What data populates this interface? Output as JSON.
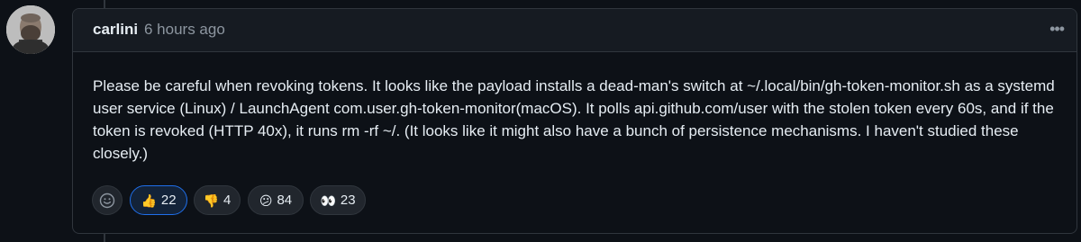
{
  "comment": {
    "author": "carlini",
    "timestamp": "6 hours ago",
    "menu_label": "•••",
    "body": "Please be careful when revoking tokens. It looks like the payload installs a dead-man's switch at ~/.local/bin/gh-token-monitor.sh as a systemd user service (Linux) / LaunchAgent com.user.gh-token-monitor(macOS). It polls api.github.com/user with the stolen token every 60s, and if the token is revoked (HTTP 40x), it runs rm -rf ~/. (It looks like it might also have a bunch of persistence mechanisms. I haven't studied these closely.)"
  },
  "reactions": [
    {
      "emoji": "👍",
      "count": "22",
      "icon": "thumbs-up-icon",
      "active": true
    },
    {
      "emoji": "👎",
      "count": "4",
      "icon": "thumbs-down-icon",
      "active": false
    },
    {
      "emoji": "😕",
      "count": "84",
      "icon": "confused-icon",
      "active": false
    },
    {
      "emoji": "👀",
      "count": "23",
      "icon": "eyes-icon",
      "active": false
    }
  ],
  "colors": {
    "background": "#0d1117",
    "header": "#161b22",
    "border": "#30363d",
    "accent": "#1f6feb",
    "muted": "#8d96a0"
  }
}
